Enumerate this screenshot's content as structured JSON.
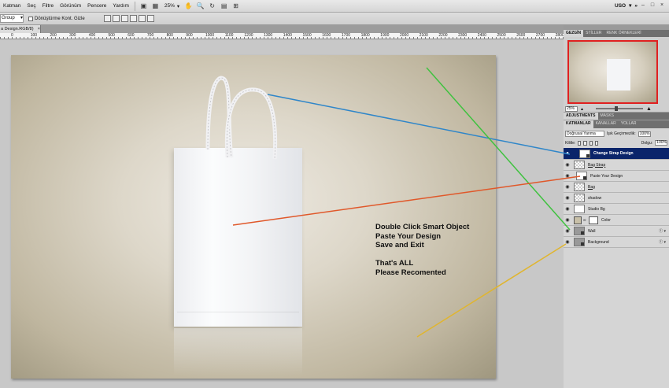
{
  "menubar": {
    "items": [
      "Katman",
      "Seç",
      "Filtre",
      "Görünüm",
      "Pencere",
      "Yardım"
    ],
    "zoom": "25%",
    "workspace": "USO"
  },
  "options": {
    "auto_select": "Group",
    "transform_label": "Dönüştürme Kont. Gizle"
  },
  "document": {
    "tab_label": "a Design.RGB/8)",
    "ruler_numbers": [
      "0",
      "100",
      "200",
      "300",
      "400",
      "500",
      "600",
      "700",
      "800",
      "900",
      "1000",
      "1100",
      "1200",
      "1300",
      "1400",
      "1500",
      "1600",
      "1700",
      "1800",
      "1900",
      "2000",
      "2100",
      "2200",
      "2300",
      "2400",
      "2500",
      "2600",
      "2700",
      "2800",
      "2900",
      "3000",
      "3100",
      "3200",
      "3300",
      "3400",
      "3500",
      "3600",
      "3700",
      "3800",
      "3900"
    ]
  },
  "canvas_text": {
    "line1": "Double Click Smart Object",
    "line2": "Paste Your Design",
    "line3": "Save and Exit",
    "line4": "",
    "line5": "That's ALL",
    "line6": "Please Recomented"
  },
  "navigator": {
    "tabs": [
      "GEZGİN",
      "STİLLER",
      "RENK ÖRNEKLERİ"
    ],
    "zoom": "25%"
  },
  "adjustments": {
    "tabs": [
      "ADJUSTMENTS",
      "MASKS"
    ]
  },
  "layers": {
    "tabs": [
      "KATMANLAR",
      "KANALLAR",
      "YOLLAR"
    ],
    "blend_mode": "Doğrusal Yanma",
    "opacity_label": "Işık Geçirmezlik:",
    "opacity": "100%",
    "lock_label": "Kilitle:",
    "fill_label": "Dolgu:",
    "fill": "100%",
    "items": [
      {
        "name": "Change Strap Design",
        "type": "smart",
        "selected": true
      },
      {
        "name": "Bag Strap",
        "type": "checker"
      },
      {
        "name": "Paste Your Design",
        "type": "smart",
        "indent": true
      },
      {
        "name": "Bag",
        "type": "checker"
      },
      {
        "name": "shadow",
        "type": "checker"
      },
      {
        "name": "Studio Bg",
        "type": "plain"
      },
      {
        "name": "Color",
        "type": "color"
      },
      {
        "name": "Wall",
        "type": "smart"
      },
      {
        "name": "Background",
        "type": "smart"
      }
    ]
  },
  "colors": {
    "arrow_blue": "#2f86c9",
    "arrow_green": "#3fc23f",
    "arrow_orange": "#e0582a",
    "arrow_yellow": "#e0b52f",
    "selected_layer": "#0a246a"
  }
}
